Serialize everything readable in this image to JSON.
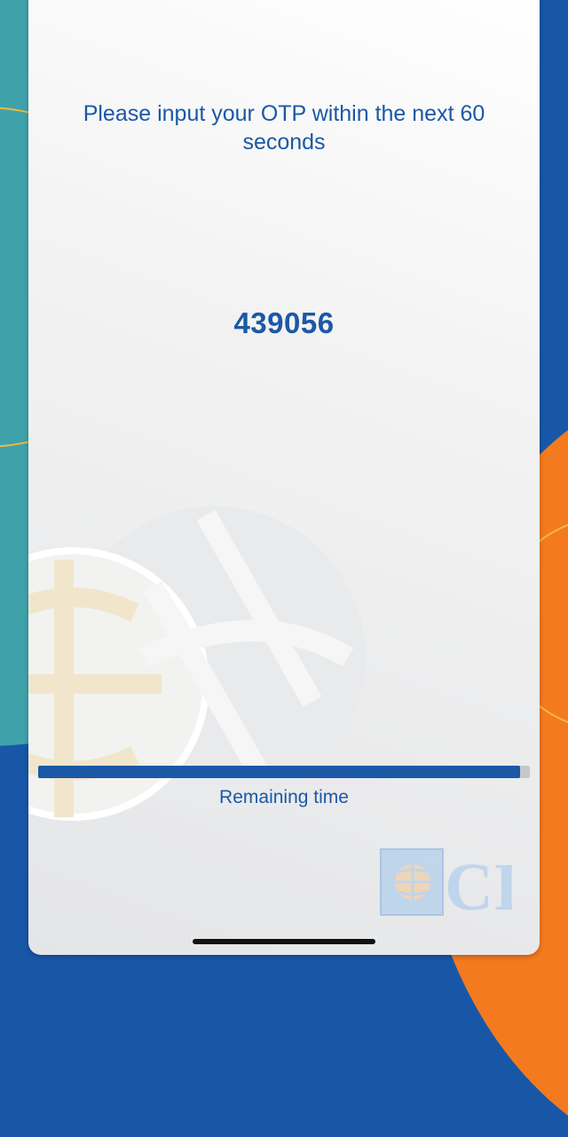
{
  "otp_screen": {
    "message": "Please input your OTP within the next 60 seconds",
    "otp_code": "439056",
    "progress_fraction": 0.98,
    "remaining_label": "Remaining time"
  },
  "logo": {
    "text": "CIB",
    "icon": "cib-globe-icon"
  },
  "colors": {
    "brand_blue": "#1857a8",
    "teal": "#3fa2ab",
    "orange": "#f47a20",
    "accent_yellow": "#f2b93b"
  }
}
